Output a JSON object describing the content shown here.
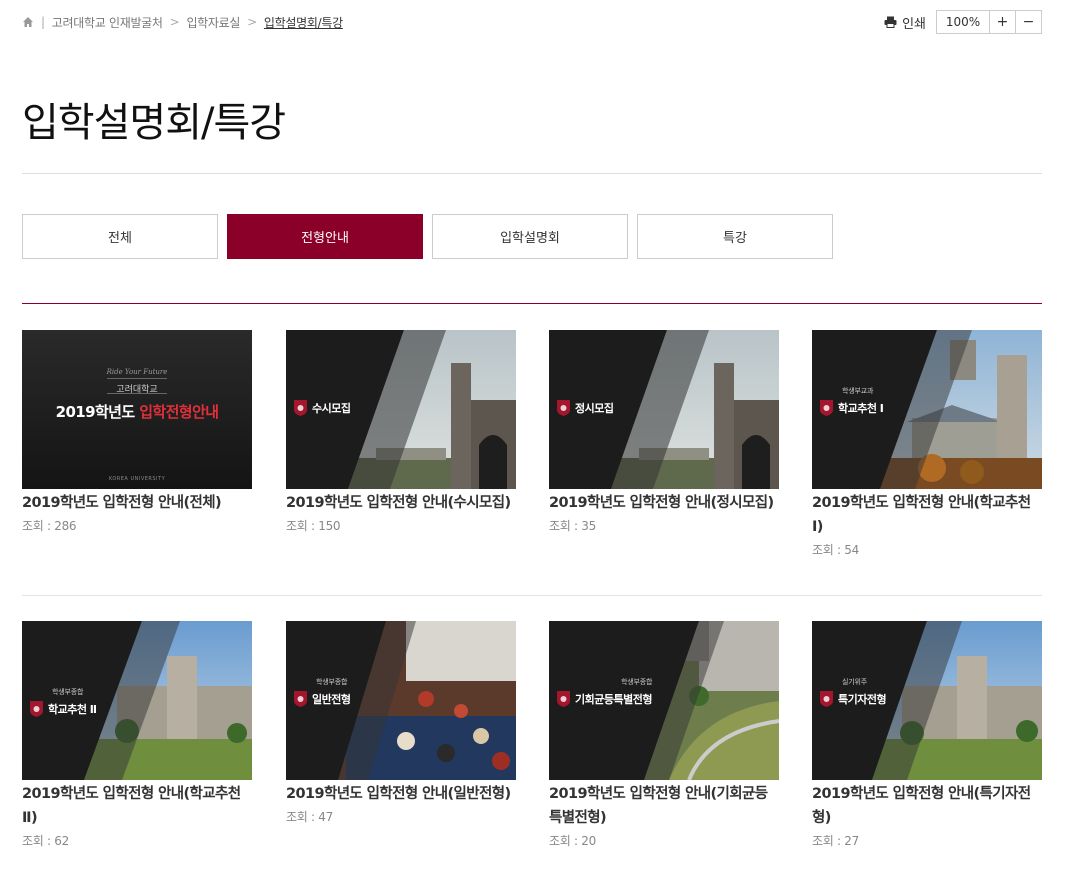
{
  "breadcrumb": {
    "home_icon": "home-icon",
    "items": [
      "고려대학교 인재발굴처",
      "입학자료실",
      "입학설명회/특강"
    ]
  },
  "tools": {
    "print_label": "인쇄",
    "zoom_value": "100%",
    "zoom_in": "+",
    "zoom_out": "−"
  },
  "page_title": "입학설명회/특강",
  "tabs": [
    {
      "label": "전체",
      "active": false
    },
    {
      "label": "전형안내",
      "active": true
    },
    {
      "label": "입학설명회",
      "active": false
    },
    {
      "label": "특강",
      "active": false
    }
  ],
  "intro_thumb": {
    "script_line": "Ride Your Future",
    "org": "고려대학교",
    "title_white": "2019학년도 ",
    "title_red": "입학전형안내",
    "footer": "KOREA UNIVERSITY"
  },
  "cards": [
    {
      "title": "2019학년도 입학전형 안내(전체)",
      "views": "조회 : 286",
      "badge": "",
      "badge_sub": ""
    },
    {
      "title": "2019학년도 입학전형 안내(수시모집)",
      "views": "조회 : 150",
      "badge": "수시모집",
      "badge_sub": ""
    },
    {
      "title": "2019학년도 입학전형 안내(정시모집)",
      "views": "조회 : 35",
      "badge": "정시모집",
      "badge_sub": ""
    },
    {
      "title": "2019학년도 입학전형 안내(학교추천 Ⅰ)",
      "views": "조회 : 54",
      "badge": "학교추천 Ⅰ",
      "badge_sub": "학생부교과"
    },
    {
      "title": "2019학년도 입학전형 안내(학교추천 Ⅱ)",
      "views": "조회 : 62",
      "badge": "학교추천 Ⅱ",
      "badge_sub": "학생부종합"
    },
    {
      "title": "2019학년도 입학전형 안내(일반전형)",
      "views": "조회 : 47",
      "badge": "일반전형",
      "badge_sub": "학생부종합"
    },
    {
      "title": "2019학년도 입학전형 안내(기회균등특별전형)",
      "views": "조회 : 20",
      "badge": "기회균등특별전형",
      "badge_sub": "학생부종합"
    },
    {
      "title": "2019학년도 입학전형 안내(특기자전형)",
      "views": "조회 : 27",
      "badge": "특기자전형",
      "badge_sub": "실기위주"
    }
  ],
  "colors": {
    "brand": "#8b0029",
    "intro_red": "#e0303a"
  }
}
